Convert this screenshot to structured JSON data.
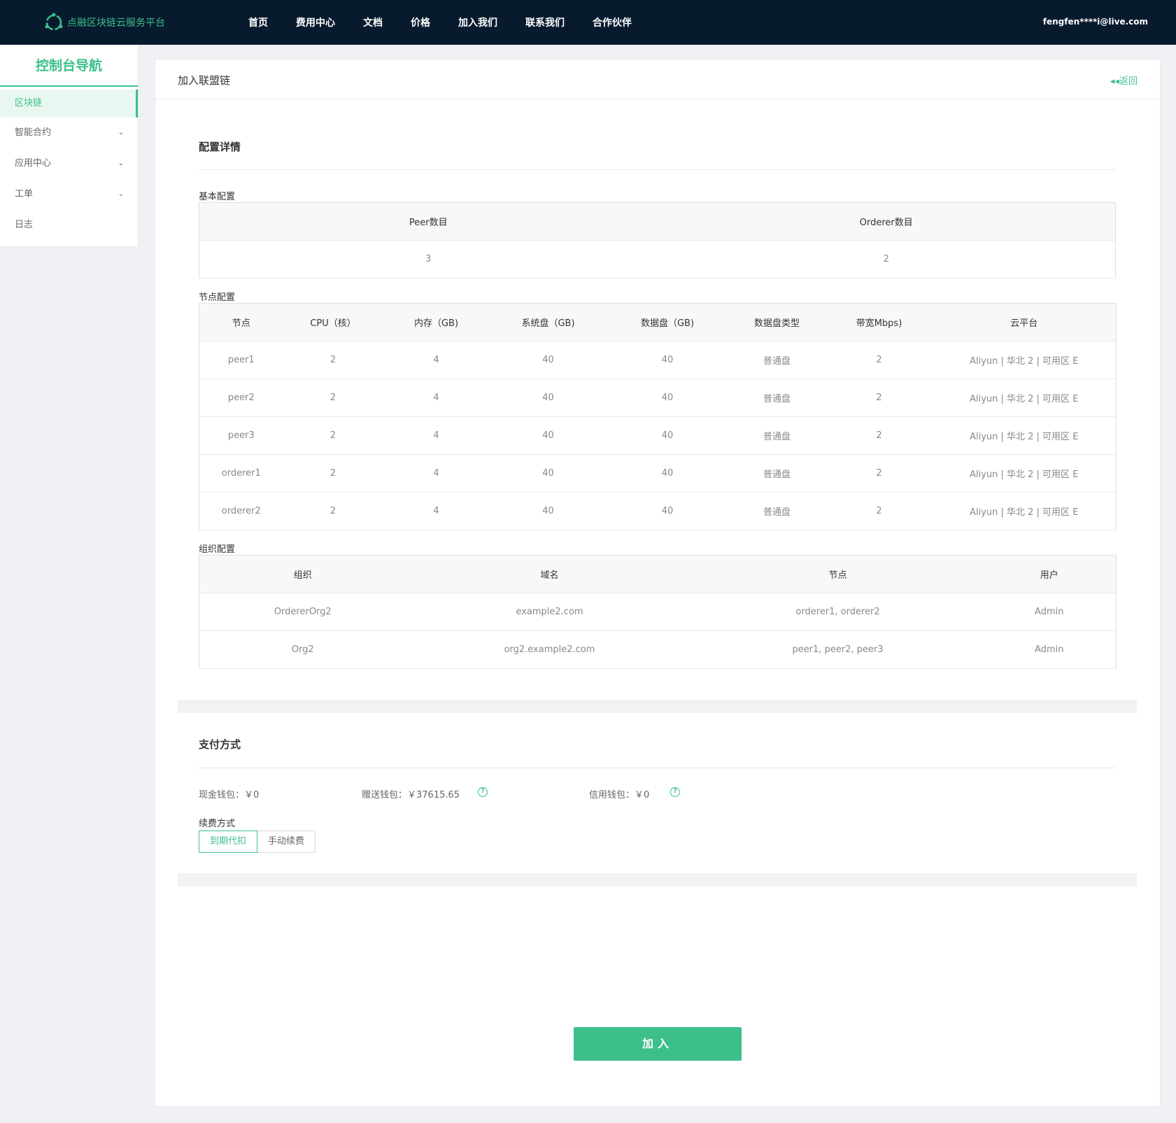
{
  "brand": {
    "name": "点融区块链云服务平台",
    "icon": "logo-ring-icon",
    "color": "#3cbf8a"
  },
  "nav": {
    "items": [
      "首页",
      "费用中心",
      "文档",
      "价格",
      "加入我们",
      "联系我们",
      "合作伙伴"
    ]
  },
  "user": {
    "email": "fengfen****i@live.com"
  },
  "sidebar": {
    "title": "控制台导航",
    "items": [
      {
        "label": "区块链",
        "active": true
      },
      {
        "label": "智能合约",
        "expandable": true
      },
      {
        "label": "应用中心",
        "expandable": true
      },
      {
        "label": "工单",
        "expandable": true
      },
      {
        "label": "日志"
      }
    ]
  },
  "page": {
    "title": "加入联盟链",
    "back": "返回"
  },
  "config": {
    "title": "配置详情",
    "basic": {
      "label": "基本配置",
      "headers": [
        "Peer数目",
        "Orderer数目"
      ],
      "values": [
        "3",
        "2"
      ]
    },
    "nodes": {
      "label": "节点配置",
      "headers": [
        "节点",
        "CPU（核）",
        "内存（GB)",
        "系统盘（GB)",
        "数据盘（GB)",
        "数据盘类型",
        "带宽Mbps)",
        "云平台"
      ],
      "rows": [
        [
          "peer1",
          "2",
          "4",
          "40",
          "40",
          "普通盘",
          "2",
          "Aliyun | 华北 2 | 可用区 E"
        ],
        [
          "peer2",
          "2",
          "4",
          "40",
          "40",
          "普通盘",
          "2",
          "Aliyun | 华北 2 | 可用区 E"
        ],
        [
          "peer3",
          "2",
          "4",
          "40",
          "40",
          "普通盘",
          "2",
          "Aliyun | 华北 2 | 可用区 E"
        ],
        [
          "orderer1",
          "2",
          "4",
          "40",
          "40",
          "普通盘",
          "2",
          "Aliyun | 华北 2 | 可用区 E"
        ],
        [
          "orderer2",
          "2",
          "4",
          "40",
          "40",
          "普通盘",
          "2",
          "Aliyun | 华北 2 | 可用区 E"
        ]
      ]
    },
    "orgs": {
      "label": "组织配置",
      "headers": [
        "组织",
        "域名",
        "节点",
        "用户"
      ],
      "rows": [
        [
          "OrdererOrg2",
          "example2.com",
          "orderer1, orderer2",
          "Admin"
        ],
        [
          "Org2",
          "org2.example2.com",
          "peer1, peer2, peer3",
          "Admin"
        ]
      ]
    }
  },
  "payment": {
    "title": "支付方式",
    "cash": "现金钱包：￥0",
    "gift": "赠送钱包：￥37615.65",
    "credit": "信用钱包：￥0",
    "renew_label": "续费方式",
    "renew_options": [
      "到期代扣",
      "手动续费"
    ],
    "renew_selected": "到期代扣"
  },
  "join_button": "加入",
  "colors": {
    "accent": "#3cbf8a",
    "topbar": "#081a2e"
  }
}
